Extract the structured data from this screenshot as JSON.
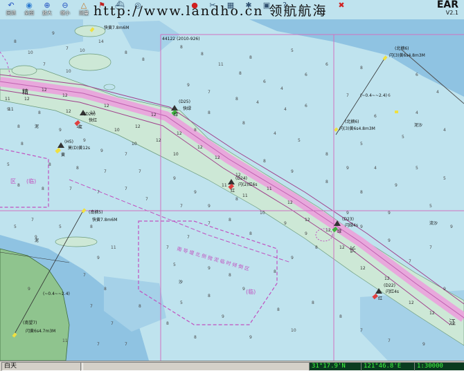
{
  "toolbar": {
    "buttons": [
      {
        "label": "回退",
        "icon": "back-icon"
      },
      {
        "label": "全图",
        "icon": "globe-icon"
      },
      {
        "label": "放大",
        "icon": "zoom-in-icon"
      },
      {
        "label": "缩小",
        "icon": "zoom-out-icon"
      },
      {
        "label": "测量",
        "icon": "measure-icon"
      },
      {
        "label": "",
        "icon": "flag-icon"
      },
      {
        "label": "",
        "icon": "ship-icon"
      },
      {
        "label": "",
        "icon": "target-icon"
      },
      {
        "label": "",
        "icon": "stop-icon"
      },
      {
        "label": "",
        "icon": "tool-icon"
      },
      {
        "label": "",
        "icon": "layer-icon"
      },
      {
        "label": "",
        "icon": "gear-icon"
      },
      {
        "label": "",
        "icon": "window-icon"
      },
      {
        "label": "",
        "icon": "help-icon"
      },
      {
        "label": "",
        "icon": "exit-icon"
      }
    ],
    "watermark": "http://www.landho.cn 领航航海",
    "brand": {
      "name": "EAR",
      "version": "V2.1"
    }
  },
  "map": {
    "chart_id": "44122 (2010-926)",
    "labels": {
      "buoy_d26": "(D26)",
      "buoy_d26_light": "快红",
      "red": "红",
      "buoy_d25": "(D25)",
      "buoy_d25_light": "快绿",
      "green": "绿",
      "buoy_h5": "(H5)",
      "buoy_h5_light": "莫(D)黄12s",
      "yellow": "黄",
      "buoy_d24": "(D24)",
      "buoy_d24_light": "闪(2)红6s",
      "buoy_d23": "(D23)",
      "buoy_d23_light": "闪绿4s",
      "buoy_d22": "(D22)",
      "buoy_d22_light": "闪红4s",
      "north_light": "(北摘6)",
      "north_light_char": "闪(3)黄6s4.8m3M",
      "south_light": "(南望7)",
      "south_light_char": "闪黄6s4.7m3M",
      "mid_light": "(南摘5)",
      "mid_light_char": "快黄7.8m6M",
      "top_light_char": "快黄7.8m6M",
      "bearing_a": "(~0.4~~2.4)",
      "bearing_b": "(~0.4~~2.4)",
      "zone_a": "区",
      "zone_b": "(临)",
      "zone_c": "(临)",
      "restricted_area": "南 导 堤 北 侧 抛 泥 临 时 倾 倒 区",
      "river_1": "长",
      "river_2": "江",
      "place_jing": "精",
      "liu_sha": "流沙",
      "ni_sha": "泥沙",
      "ni": "泥",
      "ni2": "泥",
      "sha": "沙"
    }
  },
  "status": {
    "mode": "白天",
    "lat": "31°17.9'N",
    "lon": "121°46.8'E",
    "scale": "1:30000"
  }
}
